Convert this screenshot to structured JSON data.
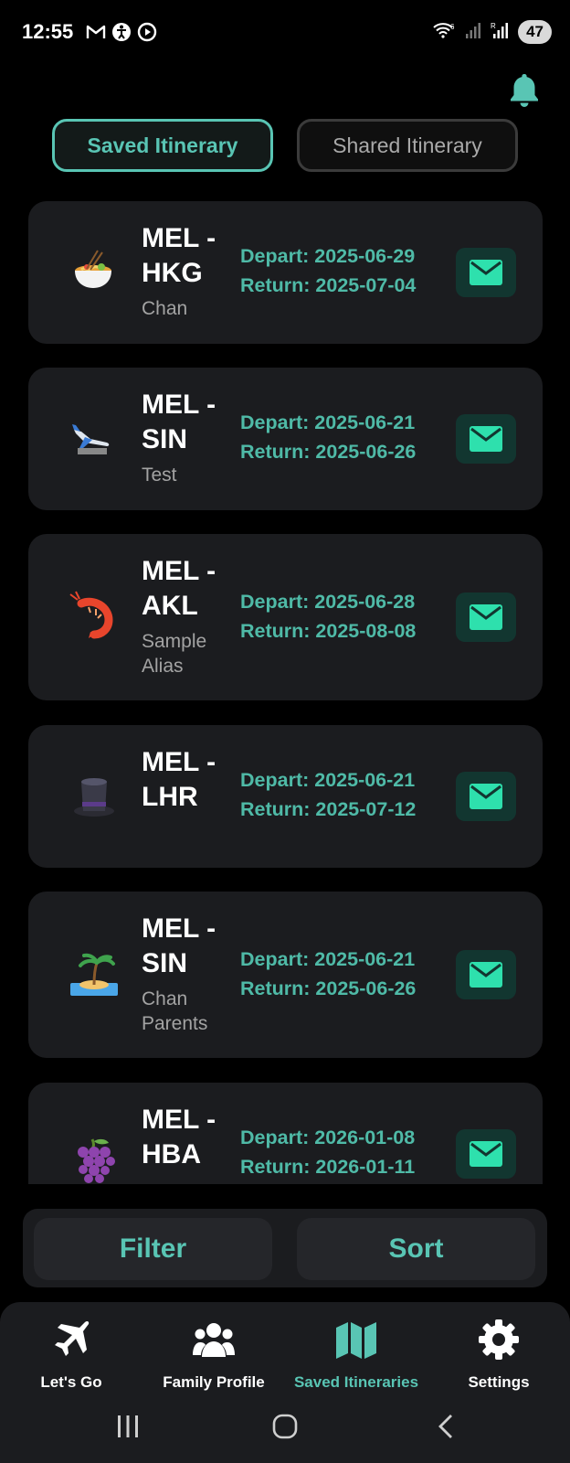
{
  "status_bar": {
    "time": "12:55",
    "battery": "47",
    "left_icons": [
      "gmail-icon",
      "accessibility-icon",
      "media-play-icon"
    ],
    "right_icons": [
      "wifi-icon",
      "signal-icon",
      "signal-icon"
    ]
  },
  "header": {
    "bell_icon": "bell-icon"
  },
  "tabs": [
    {
      "label": "Saved Itinerary",
      "active": true
    },
    {
      "label": "Shared Itinerary",
      "active": false
    }
  ],
  "itineraries": [
    {
      "emoji": "🍜",
      "route": "MEL - HKG",
      "alias": "Chan",
      "depart": "Depart: 2025-06-29",
      "return": "Return: 2025-07-04"
    },
    {
      "emoji": "🛬",
      "route": "MEL - SIN",
      "alias": "Test",
      "depart": "Depart: 2025-06-21",
      "return": "Return: 2025-06-26"
    },
    {
      "emoji": "🦐",
      "route": "MEL - AKL",
      "alias": "Sample Alias",
      "depart": "Depart: 2025-06-28",
      "return": "Return: 2025-08-08"
    },
    {
      "emoji": "🎩",
      "route": "MEL - LHR",
      "alias": "",
      "depart": "Depart: 2025-06-21",
      "return": "Return: 2025-07-12"
    },
    {
      "emoji": "🏝️",
      "route": "MEL - SIN",
      "alias": "Chan Parents",
      "depart": "Depart: 2025-06-21",
      "return": "Return: 2025-06-26"
    },
    {
      "emoji": "🍇",
      "route": "MEL - HBA",
      "alias": "",
      "depart": "Depart: 2026-01-08",
      "return": "Return: 2026-01-11"
    }
  ],
  "actions": {
    "filter": "Filter",
    "sort": "Sort"
  },
  "bottom_nav": [
    {
      "label": "Let's Go",
      "icon": "plane-icon",
      "active": false
    },
    {
      "label": "Family Profile",
      "icon": "family-icon",
      "active": false
    },
    {
      "label": "Saved Itineraries",
      "icon": "map-icon",
      "active": true
    },
    {
      "label": "Settings",
      "icon": "gear-icon",
      "active": false
    }
  ],
  "colors": {
    "accent": "#59c5b4",
    "card": "#1b1c1f",
    "mail_button": "#123630",
    "mail_icon": "#2ee0ad"
  }
}
